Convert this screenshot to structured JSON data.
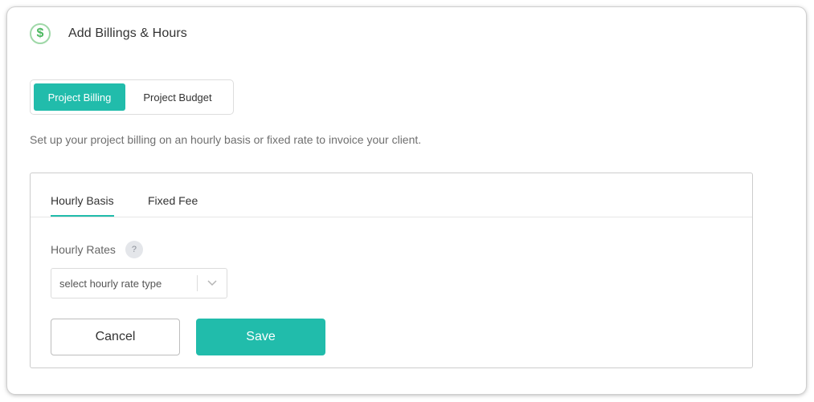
{
  "header": {
    "icon": "dollar-icon",
    "icon_glyph": "$",
    "title": "Add Billings & Hours"
  },
  "toggle": {
    "items": [
      {
        "label": "Project Billing",
        "active": true
      },
      {
        "label": "Project Budget",
        "active": false
      }
    ]
  },
  "description": "Set up your project billing on an hourly basis or fixed rate to invoice your client.",
  "card": {
    "tabs": [
      {
        "label": "Hourly Basis",
        "active": true
      },
      {
        "label": "Fixed Fee",
        "active": false
      }
    ],
    "hourly_rates_label": "Hourly Rates",
    "help_glyph": "?",
    "select": {
      "placeholder": "select hourly rate type"
    },
    "cancel_label": "Cancel",
    "save_label": "Save"
  },
  "colors": {
    "accent": "#21bcab",
    "icon_green": "#4cb860"
  }
}
